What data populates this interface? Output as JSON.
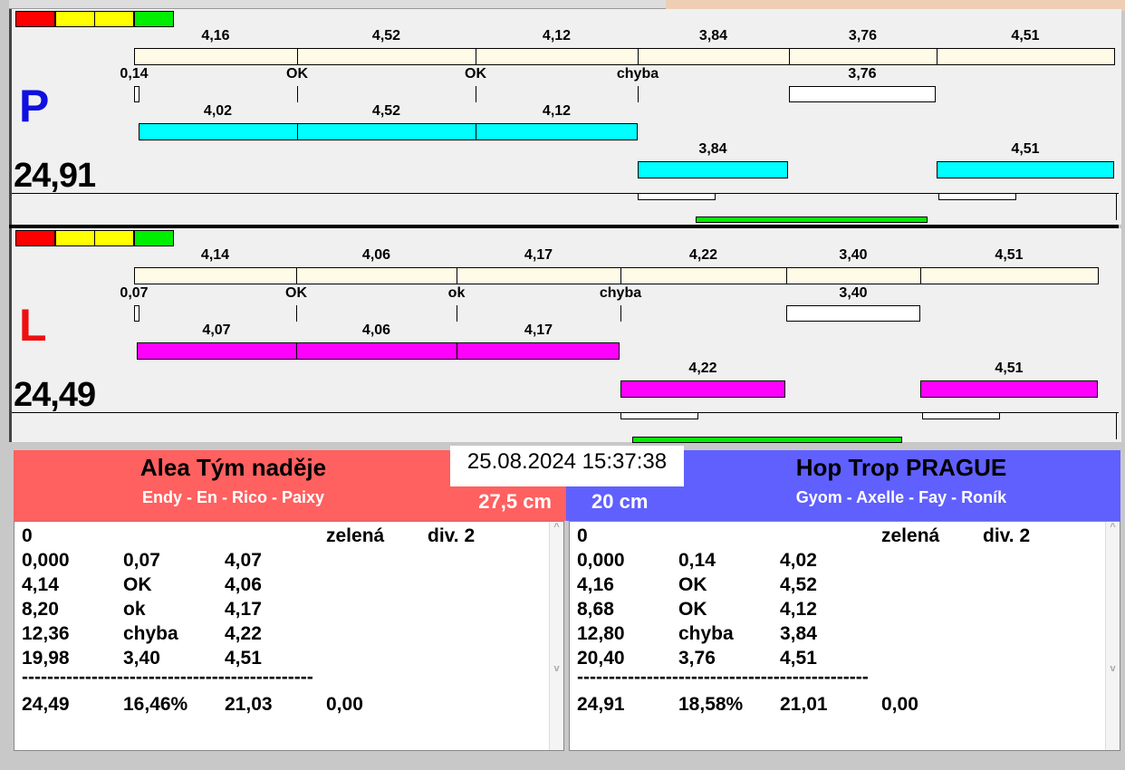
{
  "colors": {
    "red": "#ff0000",
    "yellow": "#ffff00",
    "green": "#00ee00",
    "beige": "#fffbe6",
    "cyan": "#00ffff",
    "magenta": "#ff00ff",
    "team_left": "#ff6060",
    "team_right": "#6060ff"
  },
  "lanes": [
    {
      "letter": "P",
      "letter_color": "#1010e0",
      "total": "24,91",
      "top_labels": [
        "4,16",
        "4,52",
        "4,12",
        "3,84",
        "3,76",
        "4,51"
      ],
      "mid_labels": [
        "0,14",
        "OK",
        "OK",
        "chyba",
        "3,76"
      ],
      "row2_labels": [
        "4,02",
        "4,52",
        "4,12"
      ],
      "row3_labels": [
        "3,84",
        "4,51"
      ]
    },
    {
      "letter": "L",
      "letter_color": "#ee1010",
      "total": "24,49",
      "top_labels": [
        "4,14",
        "4,06",
        "4,17",
        "4,22",
        "3,40",
        "4,51"
      ],
      "mid_labels": [
        "0,07",
        "OK",
        "ok",
        "chyba",
        "3,40"
      ],
      "row2_labels": [
        "4,07",
        "4,06",
        "4,17"
      ],
      "row3_labels": [
        "4,22",
        "4,51"
      ]
    }
  ],
  "datetime": "25.08.2024 15:37:38",
  "teams": [
    {
      "name": "Alea Tým naděje",
      "members": "Endy - En - Rico - Paixy",
      "height": "27,5 cm",
      "rows": [
        [
          "0",
          "",
          "",
          "zelená",
          "div. 2"
        ],
        [
          "0,000",
          "0,07",
          "4,07"
        ],
        [
          "4,14",
          "OK",
          "4,06"
        ],
        [
          "8,20",
          "ok",
          "4,17"
        ],
        [
          "12,36",
          "chyba",
          "4,22"
        ],
        [
          "19,98",
          "3,40",
          "4,51"
        ],
        [
          "----------------------------------------------"
        ],
        [
          "24,49",
          "16,46%",
          "21,03",
          "0,00"
        ]
      ]
    },
    {
      "name": "Hop Trop PRAGUE",
      "members": "Gyom - Axelle - Fay - Roník",
      "height": "20 cm",
      "rows": [
        [
          "0",
          "",
          "",
          "zelená",
          "div. 2"
        ],
        [
          "0,000",
          "0,14",
          "4,02"
        ],
        [
          "4,16",
          "OK",
          "4,52"
        ],
        [
          "8,68",
          "OK",
          "4,12"
        ],
        [
          "12,80",
          "chyba",
          "3,84"
        ],
        [
          "20,40",
          "3,76",
          "4,51"
        ],
        [
          "----------------------------------------------"
        ],
        [
          "24,91",
          "18,58%",
          "21,01",
          "0,00"
        ]
      ]
    }
  ]
}
